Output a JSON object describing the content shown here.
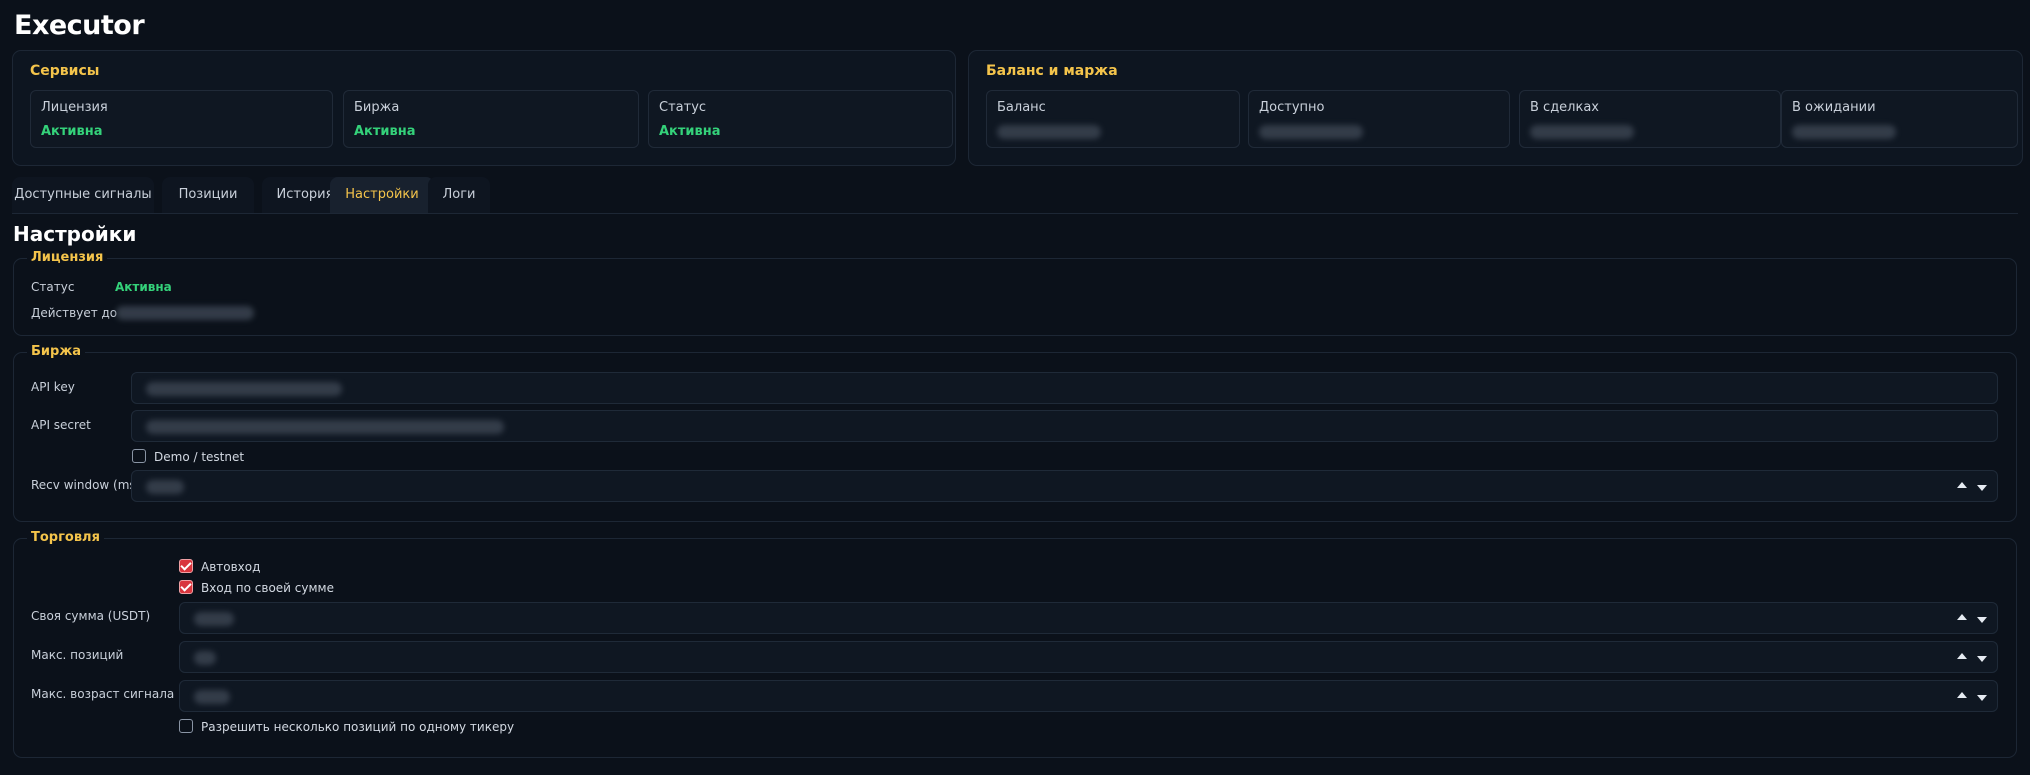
{
  "app": {
    "title": "Executor"
  },
  "services": {
    "title": "Сервисы",
    "cards": [
      {
        "label": "Лицензия",
        "value": "Активна"
      },
      {
        "label": "Биржа",
        "value": "Активна"
      },
      {
        "label": "Статус",
        "value": "Активна"
      }
    ]
  },
  "balance": {
    "title": "Баланс и маржа",
    "cards": [
      {
        "label": "Баланс"
      },
      {
        "label": "Доступно"
      },
      {
        "label": "В сделках"
      },
      {
        "label": "В ожидании"
      }
    ]
  },
  "tabs": [
    {
      "label": "Доступные сигналы"
    },
    {
      "label": "Позиции"
    },
    {
      "label": "История"
    },
    {
      "label": "Настройки",
      "active": true
    },
    {
      "label": "Логи"
    }
  ],
  "settings": {
    "heading": "Настройки",
    "license": {
      "legend": "Лицензия",
      "status_label": "Статус",
      "status_value": "Активна",
      "valid_until_label": "Действует до"
    },
    "exchange": {
      "legend": "Биржа",
      "api_key_label": "API key",
      "api_secret_label": "API secret",
      "demo_label": "Demo / testnet",
      "demo_checked": false,
      "recv_window_label": "Recv window (ms)"
    },
    "trading": {
      "legend": "Торговля",
      "autoentry_label": "Автовход",
      "autoentry_checked": true,
      "own_amount_entry_label": "Вход по своей сумме",
      "own_amount_entry_checked": true,
      "own_amount_label": "Своя сумма (USDT)",
      "max_positions_label": "Макс. позиций",
      "max_signal_age_label": "Макс. возраст сигнала (сек)",
      "allow_multiple_label": "Разрешить несколько позиций по одному тикеру",
      "allow_multiple_checked": false
    }
  },
  "colors": {
    "background": "#0b111a",
    "accent": "#f4c44b",
    "success": "#34d27a",
    "checkbox_on": "#d9363e"
  }
}
